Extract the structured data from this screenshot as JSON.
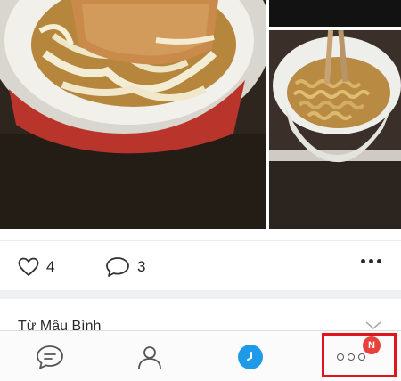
{
  "post": {
    "likes_count": "4",
    "comments_count": "3"
  },
  "next_post": {
    "author_label": "Từ Mậu Bình"
  },
  "bottom_nav": {
    "more_badge": "N",
    "active_color": "#1e9ae8",
    "badge_color": "#e8403a",
    "highlight_color": "#e0161c"
  },
  "icons": [
    "heart-icon",
    "comment-icon",
    "more-icon",
    "chevron-down-icon",
    "chat-icon",
    "contacts-icon",
    "timeline-icon",
    "more-tab-icon"
  ]
}
